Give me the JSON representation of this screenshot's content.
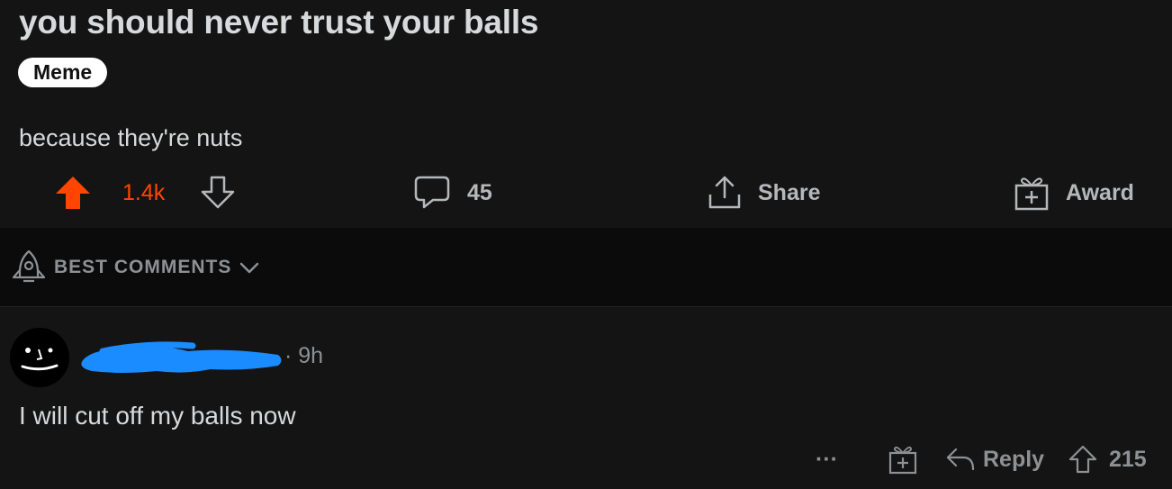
{
  "post": {
    "title": "you should never trust your balls",
    "flair": "Meme",
    "body": "because they're nuts",
    "votes": "1.4k",
    "comments_count": "45",
    "share_label": "Share",
    "award_label": "Award",
    "vote_color": "#ff4500"
  },
  "comments_sort": {
    "label": "BEST COMMENTS"
  },
  "comment": {
    "time": "9h",
    "body": "I will cut off my balls now",
    "more_label": "···",
    "reply_label": "Reply",
    "votes": "215"
  },
  "colors": {
    "background": "#141414",
    "band": "#0b0b0b",
    "redaction": "#1a8cff",
    "accent": "#ff4500"
  }
}
